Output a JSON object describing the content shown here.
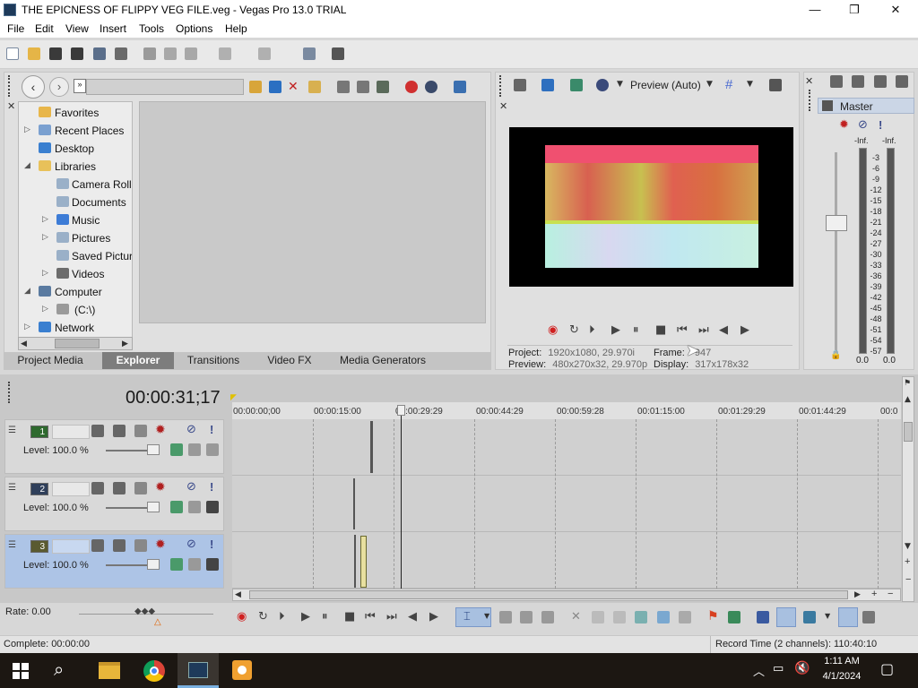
{
  "window": {
    "title": "THE EPICNESS OF FLIPPY VEG FILE.veg - Vegas Pro 13.0 TRIAL",
    "minimize": "—",
    "maximize": "❐",
    "close": "✕"
  },
  "menu": [
    "File",
    "Edit",
    "View",
    "Insert",
    "Tools",
    "Options",
    "Help"
  ],
  "explorer": {
    "tree": [
      {
        "label": "Favorites",
        "arrow": "",
        "icon_color": "#e8b64a"
      },
      {
        "label": "Recent Places",
        "arrow": "▷",
        "icon_color": "#7aa0d0"
      },
      {
        "label": "Desktop",
        "arrow": "",
        "icon_color": "#3a7fd0"
      },
      {
        "label": "Libraries",
        "arrow": "◢",
        "icon_color": "#e8c15a"
      },
      {
        "label": "Camera Roll",
        "arrow": "",
        "icon_color": "#9ab0c8"
      },
      {
        "label": "Documents",
        "arrow": "",
        "icon_color": "#9ab0c8"
      },
      {
        "label": "Music",
        "arrow": "▷",
        "icon_color": "#3d7cd6"
      },
      {
        "label": "Pictures",
        "arrow": "▷",
        "icon_color": "#9ab0c8"
      },
      {
        "label": "Saved Pictures",
        "arrow": "",
        "icon_color": "#9ab0c8"
      },
      {
        "label": "Videos",
        "arrow": "▷",
        "icon_color": "#6c6c6c"
      },
      {
        "label": "Computer",
        "arrow": "◢",
        "icon_color": "#5a7aa0"
      },
      {
        "label": "(C:\\)",
        "arrow": "▷",
        "icon_color": "#9a9a9a"
      },
      {
        "label": "Network",
        "arrow": "▷",
        "icon_color": "#3a7fd0"
      }
    ],
    "tabs": [
      "Project Media",
      "Explorer",
      "Transitions",
      "Video FX",
      "Media Generators"
    ],
    "active_tab": "Explorer"
  },
  "preview": {
    "mode_label": "Preview (Auto)",
    "project_label": "Project:",
    "project_value": "1920x1080, 29.970i",
    "preview_label": "Preview:",
    "preview_value": "480x270x32, 29.970p",
    "frame_label": "Frame:",
    "frame_value": "947",
    "display_label": "Display:",
    "display_value": "317x178x32"
  },
  "mixer": {
    "master_label": "Master",
    "inf_left": "-Inf.",
    "inf_right": "-Inf.",
    "scale": [
      "3",
      "6",
      "9",
      "12",
      "15",
      "18",
      "21",
      "24",
      "27",
      "30",
      "33",
      "36",
      "39",
      "42",
      "45",
      "48",
      "51",
      "54",
      "57"
    ],
    "value_left": "0.0",
    "value_right": "0.0"
  },
  "timeline": {
    "timecode": "00:00:31;17",
    "ruler": [
      "00:00:00;00",
      "00:00:15:00",
      "00:00:29:29",
      "00:00:44:29",
      "00:00:59:28",
      "00:01:15:00",
      "00:01:29:29",
      "00:01:44:29",
      "00:0"
    ],
    "tracks": [
      {
        "num": "1",
        "level": "Level: 100.0 %"
      },
      {
        "num": "2",
        "level": "Level: 100.0 %"
      },
      {
        "num": "3",
        "level": "Level: 100.0 %"
      }
    ],
    "rate": "Rate: 0.00"
  },
  "status": {
    "complete": "Complete: 00:00:00",
    "record_time": "Record Time (2 channels): 110:40:10"
  },
  "taskbar": {
    "time": "1:11 AM",
    "date": "4/1/2024"
  }
}
